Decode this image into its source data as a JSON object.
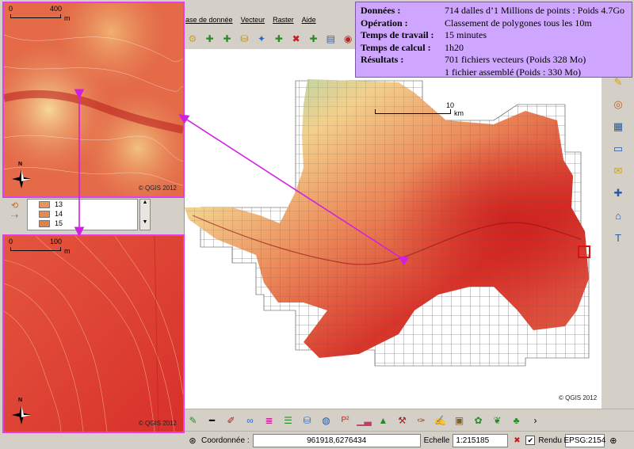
{
  "menubar": {
    "items": [
      "ase de donnée",
      "Vecteur",
      "Raster",
      "Aide"
    ]
  },
  "main_map": {
    "scale_label": "10",
    "scale_unit": "km",
    "copyright": "© QGIS 2012"
  },
  "inset_top": {
    "scale_start": "0",
    "scale_end": "400",
    "scale_unit": "m",
    "north_label": "N",
    "copyright": "© QGIS 2012"
  },
  "inset_bottom": {
    "scale_start": "0",
    "scale_end": "100",
    "scale_unit": "m",
    "north_label": "N",
    "copyright": "© QGIS 2012"
  },
  "legend": {
    "items": [
      {
        "label": "13",
        "color": "#e8955a"
      },
      {
        "label": "14",
        "color": "#e58a52"
      },
      {
        "label": "15",
        "color": "#e27f4a"
      }
    ]
  },
  "info_panel": {
    "rows": [
      {
        "key": "Données :",
        "value": "714 dalles d’1 Millions de points : Poids 4.7Go"
      },
      {
        "key": "Opération :",
        "value": "Classement de polygones tous les 10m"
      },
      {
        "key": "Temps de travail :",
        "value": "15 minutes"
      },
      {
        "key": "Temps de calcul :",
        "value": "1h20"
      },
      {
        "key": "Résultats :",
        "value": "701 fichiers vecteurs (Poids 328 Mo)"
      },
      {
        "key": "",
        "value": "1 fichier assemblé (Poids : 330 Mo)"
      }
    ],
    "background": "#cfa6ff"
  },
  "statusbar": {
    "coord_label": "Coordonnée :",
    "coord_value": "961918,6276434",
    "scale_label": "Echelle",
    "scale_value": "1:215185",
    "render_label": "Rendu",
    "epsg": "EPSG:2154"
  },
  "colors": {
    "inset_border": "#e040e8",
    "arrow": "#d020e0",
    "selection_box": "#e01010"
  }
}
